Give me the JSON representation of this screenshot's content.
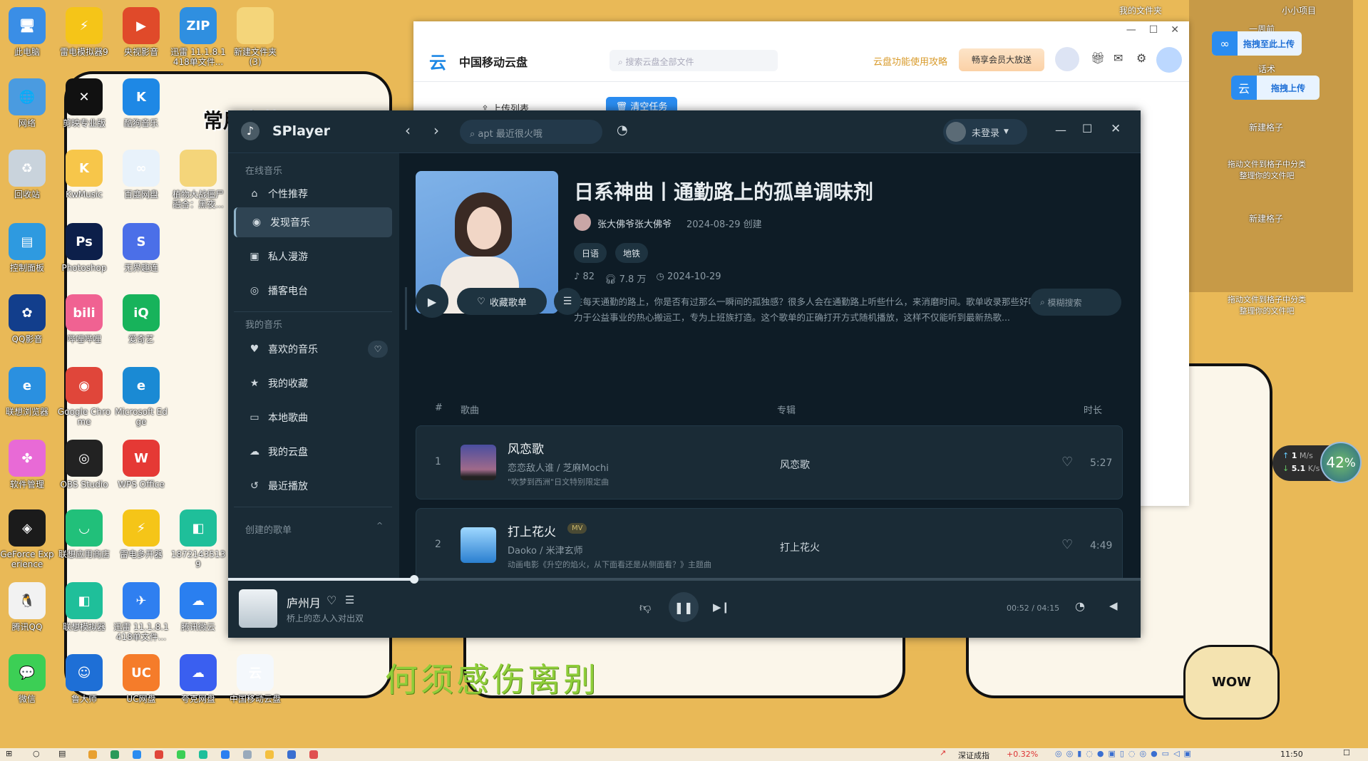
{
  "desktop": {
    "icons": [
      {
        "label": "此电脑",
        "color": "#3a8ee6",
        "glyph": "🖥"
      },
      {
        "label": "雷电模拟器9",
        "color": "#f5c518",
        "glyph": "⚡"
      },
      {
        "label": "央视影音",
        "color": "#e04a2a",
        "glyph": "▶"
      },
      {
        "label": "迅雷 11.1.8.1418单文件...",
        "color": "#2f8fe0",
        "glyph": "ZIP"
      },
      {
        "label": "新建文件夹 (3)",
        "color": "#f4d57a",
        "glyph": ""
      },
      {
        "label": "网络",
        "color": "#4a9be0",
        "glyph": "🌐"
      },
      {
        "label": "剪映专业版",
        "color": "#111111",
        "glyph": "✕"
      },
      {
        "label": "酷狗音乐",
        "color": "#1e88e5",
        "glyph": "K"
      },
      {
        "label": "回收站",
        "color": "#c9d3dc",
        "glyph": "♻"
      },
      {
        "label": "KwMusic",
        "color": "#f7c64a",
        "glyph": "K"
      },
      {
        "label": "百度网盘",
        "color": "#e8f2fb",
        "glyph": "∞"
      },
      {
        "label": "植物大战僵尸融合：黑夜...",
        "color": "#f4d57a",
        "glyph": ""
      },
      {
        "label": "控制面板",
        "color": "#2e9ae0",
        "glyph": "▤"
      },
      {
        "label": "Photoshop",
        "color": "#0c1f4a",
        "glyph": "Ps"
      },
      {
        "label": "无界趣连",
        "color": "#4b6fe8",
        "glyph": "S"
      },
      {
        "label": "QQ影音",
        "color": "#123e8c",
        "glyph": "✿"
      },
      {
        "label": "哔哩哔哩",
        "color": "#f06292",
        "glyph": "bili"
      },
      {
        "label": "爱奇艺",
        "color": "#17b35b",
        "glyph": "iQ"
      },
      {
        "label": "联想浏览器",
        "color": "#2a90e0",
        "glyph": "e"
      },
      {
        "label": "Google Chrome",
        "color": "#e0463a",
        "glyph": "◉"
      },
      {
        "label": "Microsoft Edge",
        "color": "#1a8ad4",
        "glyph": "e"
      },
      {
        "label": "软件管理",
        "color": "#e86ad6",
        "glyph": "✤"
      },
      {
        "label": "OBS Studio",
        "color": "#222222",
        "glyph": "◎"
      },
      {
        "label": "WPS Office",
        "color": "#e53935",
        "glyph": "W"
      },
      {
        "label": "GeForce Experience",
        "color": "#1b1b1b",
        "glyph": "◈"
      },
      {
        "label": "联想应用商店",
        "color": "#21c07a",
        "glyph": "◡"
      },
      {
        "label": "雷电多开器",
        "color": "#f5c518",
        "glyph": "⚡"
      },
      {
        "label": "18721435139",
        "color": "#1fbf9a",
        "glyph": "◧"
      },
      {
        "label": "腾讯QQ",
        "color": "#f2f2f2",
        "glyph": "🐧"
      },
      {
        "label": "联想模拟器",
        "color": "#1fbf9a",
        "glyph": "◧"
      },
      {
        "label": "迅雷 11.1.8.1418单文件...",
        "color": "#2f7ff0",
        "glyph": "✈"
      },
      {
        "label": "腾讯微云",
        "color": "#2a7ff0",
        "glyph": "☁"
      },
      {
        "label": "微信",
        "color": "#3ccf55",
        "glyph": "💬"
      },
      {
        "label": "鲁大师",
        "color": "#1e6fd6",
        "glyph": "☺"
      },
      {
        "label": "UC网盘",
        "color": "#f57c2a",
        "glyph": "UC"
      },
      {
        "label": "夸克网盘",
        "color": "#3a5ff0",
        "glyph": "☁"
      },
      {
        "label": "中国移动云盘",
        "color": "#f4f8fc",
        "glyph": "云"
      }
    ],
    "panel_text": "常用文件",
    "lyric_overlay": "何须感伤离别",
    "fences": {
      "my_folder": "我的文件夹",
      "small_project": "小小项目",
      "week": "一周前",
      "file_huashu": "话术",
      "new_grid": "新建格子",
      "hint": "拖动文件到格子中分类整理你的文件吧"
    },
    "float_upload_baidu": "拖拽至此上传",
    "float_upload_cmcc": "拖拽上传",
    "net_speed": {
      "up": "1",
      "up_unit": "M/s",
      "down": "5.1",
      "down_unit": "K/s",
      "percent": "42"
    }
  },
  "cloud_window": {
    "app_name": "中国移动云盘",
    "search_placeholder": "搜索云盘全部文件",
    "guide_link": "云盘功能使用攻略",
    "promo_button": "畅享会员大放送",
    "sidebar_upload_list": "上传列表",
    "clear_tasks": "清空任务"
  },
  "splayer": {
    "app_name": "SPlayer",
    "search_placeholder": "apt 最近很火哦",
    "user": "未登录",
    "sidebar": {
      "online_head": "在线音乐",
      "online": [
        {
          "label": "个性推荐",
          "icon": "home"
        },
        {
          "label": "发现音乐",
          "icon": "disc",
          "active": true
        },
        {
          "label": "私人漫游",
          "icon": "radio"
        },
        {
          "label": "播客电台",
          "icon": "podcast"
        }
      ],
      "mine_head": "我的音乐",
      "mine": [
        {
          "label": "喜欢的音乐",
          "icon": "heart"
        },
        {
          "label": "我的收藏",
          "icon": "star"
        },
        {
          "label": "本地歌曲",
          "icon": "folder"
        },
        {
          "label": "我的云盘",
          "icon": "cloud"
        },
        {
          "label": "最近播放",
          "icon": "history"
        }
      ],
      "created_head": "创建的歌单"
    },
    "playlist": {
      "title": "日系神曲丨通勤路上的孤单调味剂",
      "creator": "张大佛爷张大佛爷",
      "created": "2024-08-29 创建",
      "tags": [
        "日语",
        "地铁"
      ],
      "song_count": "82",
      "plays": "7.8 万",
      "updated": "2024-10-29",
      "description": "在每天通勤的路上，你是否有过那么一瞬间的孤独感？很多人会在通勤路上听些什么，来消磨时间。歌单收录那些好听的日系神曲，我是致力于公益事业的热心搬运工，专为上班族打造。这个歌单的正确打开方式随机播放，这样不仅能听到最新热歌...",
      "collect": "收藏歌单",
      "fuzzy_search": "模糊搜索"
    },
    "columns": {
      "num": "#",
      "song": "歌曲",
      "album": "专辑",
      "duration": "时长"
    },
    "songs": [
      {
        "num": "1",
        "title": "风恋歌",
        "artists": "恋恋敌人谁 / 芝麻Mochi",
        "desc": "\"吹梦到西洲\"日文特别限定曲",
        "album": "风恋歌",
        "duration": "5:27",
        "mv": ""
      },
      {
        "num": "2",
        "title": "打上花火",
        "artists": "Daoko / 米津玄师",
        "desc": "动画电影《升空的焰火，从下面看还是从侧面看？》主题曲",
        "album": "打上花火",
        "duration": "4:49",
        "mv": "MV"
      }
    ],
    "now_playing": {
      "title": "庐州月",
      "subtitle": "桥上的恋人入对出双",
      "time": "00:52 / 04:15",
      "progress": 0.204
    }
  },
  "taskbar": {
    "stock_name": "深证成指",
    "stock_change": "+0.32%",
    "time": "11:50"
  }
}
